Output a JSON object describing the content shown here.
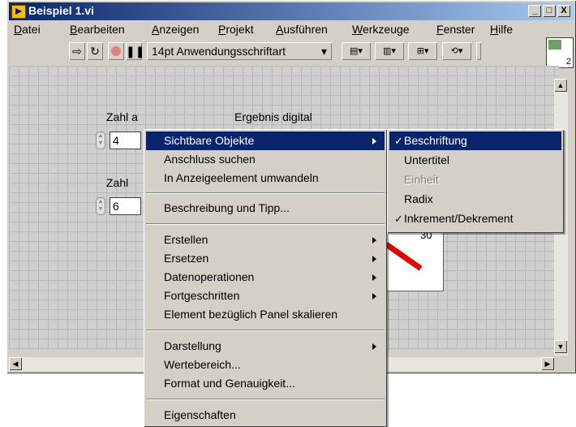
{
  "window": {
    "title": "Beispiel 1.vi",
    "minimize": "_",
    "maximize": "□",
    "close": "X"
  },
  "menubar": [
    "Datei",
    "Bearbeiten",
    "Anzeigen",
    "Projekt",
    "Ausführen",
    "Werkzeuge",
    "Fenster",
    "Hilfe"
  ],
  "toolbar": {
    "font": "14pt Anwendungsschriftart",
    "icon_number": "2"
  },
  "panel": {
    "zahl_a_label": "Zahl a",
    "zahl_a_value": "4",
    "zahl_b_label": "Zahl",
    "zahl_b_value": "6",
    "ergebnis_label": "Ergebnis digital",
    "gauge_value": "30"
  },
  "context_menu": {
    "items": [
      {
        "label": "Sichtbare Objekte"
      },
      {
        "label": "Anschluss suchen"
      },
      {
        "label": "In Anzeigeelement umwandeln"
      },
      {
        "label": "Beschreibung und Tipp..."
      },
      {
        "label": "Erstellen"
      },
      {
        "label": "Ersetzen"
      },
      {
        "label": "Datenoperationen"
      },
      {
        "label": "Fortgeschritten"
      },
      {
        "label": "Element bezüglich Panel skalieren"
      },
      {
        "label": "Darstellung"
      },
      {
        "label": "Wertebereich..."
      },
      {
        "label": "Format und Genauigkeit..."
      },
      {
        "label": "Eigenschaften"
      }
    ]
  },
  "submenu": {
    "items": [
      {
        "label": "Beschriftung",
        "check": "✓"
      },
      {
        "label": "Untertitel"
      },
      {
        "label": "Einheit"
      },
      {
        "label": "Radix"
      },
      {
        "label": "Inkrement/Dekrement",
        "check": "✓"
      }
    ]
  },
  "colors": {
    "highlight": "#0a246a",
    "grid": "#b8b8b8",
    "gauge_needle": "#e00000"
  }
}
